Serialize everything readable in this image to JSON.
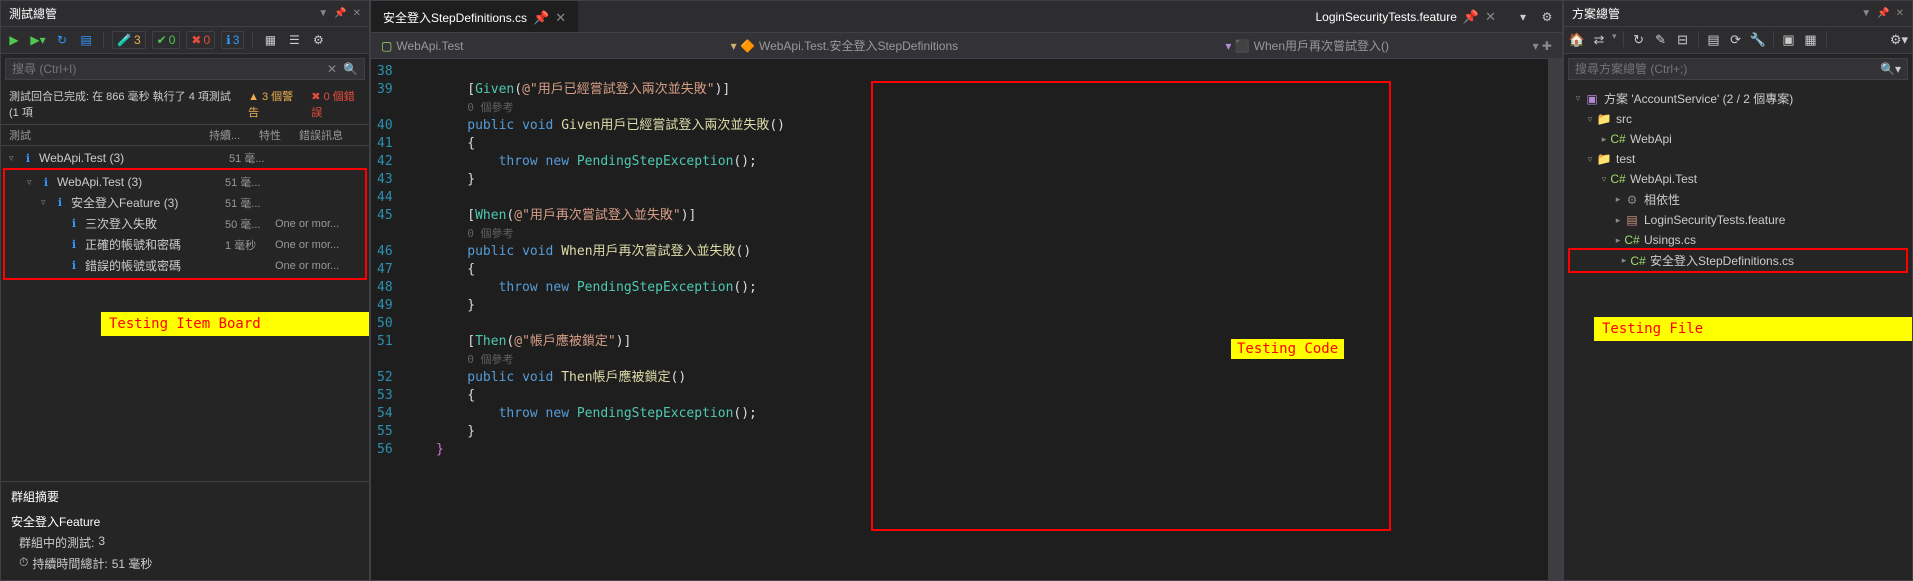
{
  "test_explorer": {
    "title": "測試總管",
    "search_placeholder": "搜尋 (Ctrl+I)",
    "toolbar_badges": {
      "warn": "3",
      "pass": "0",
      "fail": "0",
      "info": "3"
    },
    "summary": {
      "text": "測試回合已完成: 在 866 毫秒 執行了 4 項測試 (1 項",
      "warn": "▲ 3 個警告",
      "err": "✖ 0 個錯誤"
    },
    "columns": {
      "c1": "測試",
      "c2": "持續...",
      "c3": "特性",
      "c4": "錯誤訊息"
    },
    "root": {
      "label": "WebApi.Test (3)",
      "dur": "51 毫..."
    },
    "nested": [
      {
        "label": "WebApi.Test (3)",
        "dur": "51 毫...",
        "det": "",
        "indent": 1
      },
      {
        "label": "安全登入Feature (3)",
        "dur": "51 毫...",
        "det": "",
        "indent": 2
      },
      {
        "label": "三次登入失敗",
        "dur": "50 毫...",
        "det": "One or mor...",
        "indent": 3
      },
      {
        "label": "正確的帳號和密碼",
        "dur": "1 毫秒",
        "det": "One or mor...",
        "indent": 3
      },
      {
        "label": "錯誤的帳號或密碼",
        "dur": "",
        "det": "One or mor...",
        "indent": 3
      }
    ],
    "callout": "Testing Item Board",
    "group_summary": {
      "heading": "群組摘要",
      "title": "安全登入Feature",
      "tests_in_group_label": "群組中的測試:",
      "tests_in_group_val": "3",
      "duration_label": "持續時間總計:",
      "duration_val": "51 毫秒"
    }
  },
  "editor": {
    "tabs": {
      "active": "安全登入StepDefinitions.cs",
      "right": "LoginSecurityTests.feature"
    },
    "crumb": {
      "project": "WebApi.Test",
      "class": "WebApi.Test.安全登入StepDefinitions",
      "method": "When用戶再次嘗試登入()"
    },
    "callout": "Testing Code",
    "lines": [
      {
        "n": 38,
        "t": ""
      },
      {
        "n": 39,
        "html": "        [<span class='attr'>Given</span>(<span class='str'>@\"用戶已經嘗試登入兩次並失敗\"</span>)]"
      },
      {
        "n": "",
        "html": "        <span class='ref'>0 個參考</span>"
      },
      {
        "n": 40,
        "html": "        <span class='kw'>public</span> <span class='kw'>void</span> <span class='method'>Given用戶已經嘗試登入兩次並失敗</span>()"
      },
      {
        "n": 41,
        "html": "        {"
      },
      {
        "n": 42,
        "html": "            <span class='kw'>throw</span> <span class='kw'>new</span> <span class='type'>PendingStepException</span>();"
      },
      {
        "n": 43,
        "html": "        }"
      },
      {
        "n": 44,
        "t": ""
      },
      {
        "n": 45,
        "html": "        [<span class='attr'>When</span>(<span class='str'>@\"用戶再次嘗試登入並失敗\"</span>)]"
      },
      {
        "n": "",
        "html": "        <span class='ref'>0 個參考</span>"
      },
      {
        "n": 46,
        "html": "        <span class='kw'>public</span> <span class='kw'>void</span> <span class='method'>When用戶再次嘗試登入並失敗</span>()"
      },
      {
        "n": 47,
        "html": "        {"
      },
      {
        "n": 48,
        "html": "            <span class='kw'>throw</span> <span class='kw'>new</span> <span class='type'>PendingStepException</span>();"
      },
      {
        "n": 49,
        "html": "        }"
      },
      {
        "n": 50,
        "t": ""
      },
      {
        "n": 51,
        "html": "        [<span class='attr'>Then</span>(<span class='str'>@\"帳戶應被鎖定\"</span>)]"
      },
      {
        "n": "",
        "html": "        <span class='ref'>0 個參考</span>"
      },
      {
        "n": 52,
        "html": "        <span class='kw'>public</span> <span class='kw'>void</span> <span class='method'>Then帳戶應被鎖定</span>()"
      },
      {
        "n": 53,
        "html": "        {"
      },
      {
        "n": 54,
        "html": "            <span class='kw'>throw</span> <span class='kw'>new</span> <span class='type'>PendingStepException</span>();"
      },
      {
        "n": 55,
        "html": "        }"
      },
      {
        "n": 56,
        "html": "    <span class='br'>}</span>"
      }
    ]
  },
  "solution": {
    "title": "方案總管",
    "search_placeholder": "搜尋方案總管 (Ctrl+;)",
    "root": "方案 'AccountService' (2 / 2 個專案)",
    "nodes": {
      "src": "src",
      "webapi": "WebApi",
      "test": "test",
      "webapitest": "WebApi.Test",
      "deps": "相依性",
      "feature": "LoginSecurityTests.feature",
      "usings": "Usings.cs",
      "stepdef": "安全登入StepDefinitions.cs"
    },
    "callout": "Testing File"
  }
}
